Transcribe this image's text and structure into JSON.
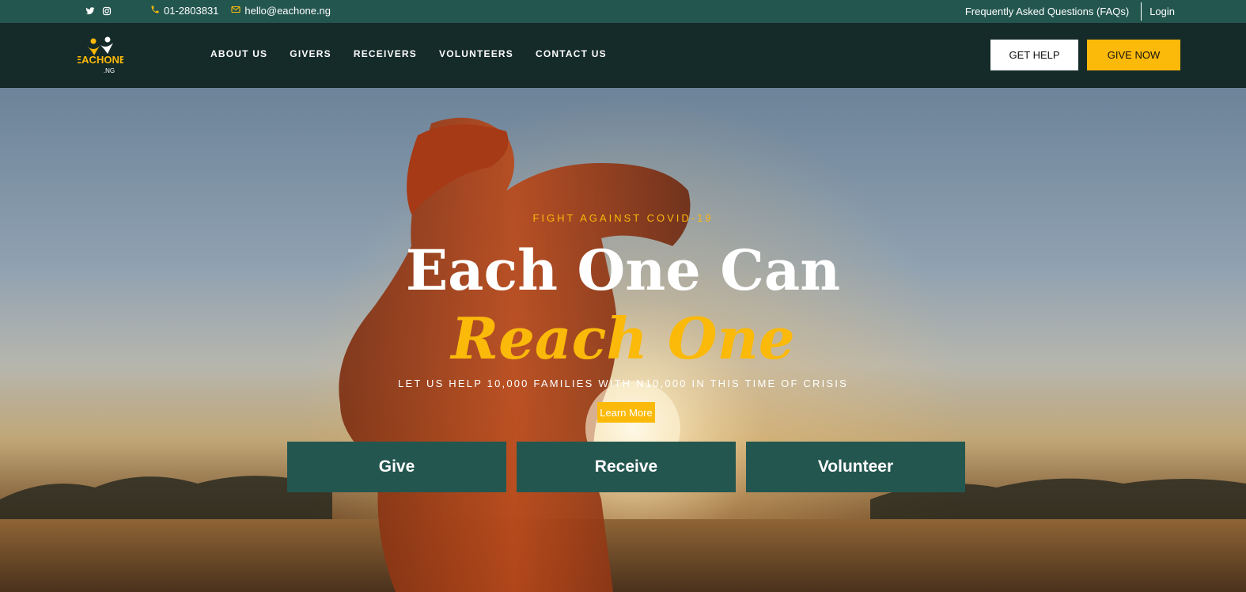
{
  "topbar": {
    "social_icons": [
      "twitter-icon",
      "instagram-icon"
    ],
    "phone": "01-2803831",
    "email": "hello@eachone.ng",
    "faq_link": "Frequently Asked Questions (FAQs)",
    "login_link": "Login"
  },
  "brand": {
    "logo_text": "EACHONE",
    "logo_suffix": ".NG"
  },
  "nav": {
    "links": [
      "ABOUT US",
      "GIVERS",
      "RECEIVERS",
      "VOLUNTEERS",
      "CONTACT US"
    ],
    "get_help": "GET HELP",
    "give_now": "GIVE NOW"
  },
  "hero": {
    "kicker": "FIGHT AGAINST COVID-19",
    "headline_line1": "Each One Can",
    "headline_line2": "Reach One",
    "subtitle": "LET US HELP 10,000 FAMILIES WITH N10,000 IN THIS TIME OF CRISIS",
    "learn_more": "Learn More",
    "cta_give": "Give",
    "cta_receive": "Receive",
    "cta_volunteer": "Volunteer"
  },
  "colors": {
    "accent": "#fbb909",
    "topbar": "#245650",
    "navbar": "#152b29",
    "cta": "#245650"
  }
}
